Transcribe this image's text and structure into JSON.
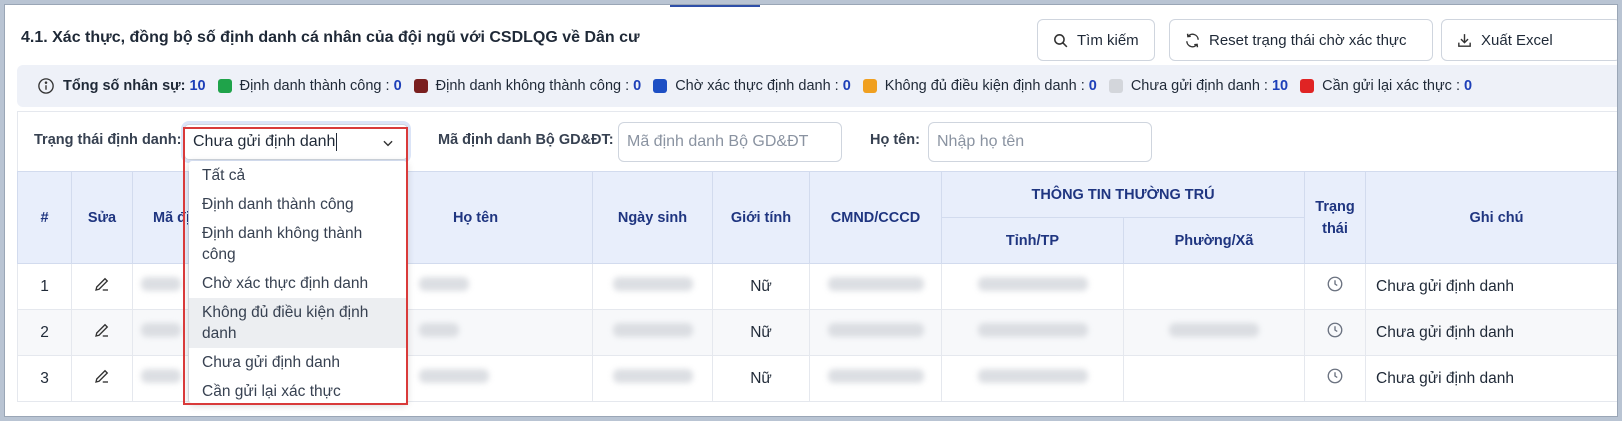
{
  "header": {
    "title": "4.1. Xác thực, đồng bộ số định danh cá nhân của đội ngũ với CSDLQG về Dân cư",
    "buttons": {
      "search": "Tìm kiếm",
      "reset": "Reset trạng thái chờ xác thực",
      "excel": "Xuất Excel"
    }
  },
  "summary": {
    "total_label": "Tổng số nhân sự:",
    "total_value": "10",
    "items": [
      {
        "label": "Định danh thành công :",
        "value": "0",
        "color": "#1fa34a"
      },
      {
        "label": "Định danh không thành công :",
        "value": "0",
        "color": "#7a1f1f"
      },
      {
        "label": "Chờ xác thực định danh :",
        "value": "0",
        "color": "#1d4fc4"
      },
      {
        "label": "Không đủ điều kiện định danh :",
        "value": "0",
        "color": "#f0a020"
      },
      {
        "label": "Chưa gửi định danh :",
        "value": "10",
        "color": "#d3d6db"
      },
      {
        "label": "Cần gửi lại xác thực :",
        "value": "0",
        "color": "#e02424"
      }
    ]
  },
  "filters": {
    "status_label": "Trạng thái định danh:",
    "status_value": "Chưa gửi định danh",
    "moet_id_label": "Mã định danh Bộ GD&ĐT:",
    "moet_id_placeholder": "Mã định danh Bộ GD&ĐT",
    "name_label": "Họ tên:",
    "name_placeholder": "Nhập họ tên"
  },
  "dropdown": {
    "options": [
      "Tất cả",
      "Định danh thành công",
      "Định danh không thành công",
      "Chờ xác thực định danh",
      "Không đủ điều kiện định danh",
      "Chưa gửi định danh",
      "Cần gửi lại xác thực"
    ],
    "hovered_index": 4
  },
  "table": {
    "headers": {
      "index": "#",
      "edit": "Sửa",
      "code": "Mã định danh",
      "name": "Họ tên",
      "dob": "Ngày sinh",
      "gender": "Giới tính",
      "id_card": "CMND/CCCD",
      "residence": "THÔNG TIN THƯỜNG TRÚ",
      "province": "Tỉnh/TP",
      "ward": "Phường/Xã",
      "status": "Trạng thái",
      "note": "Ghi chú"
    },
    "rows": [
      {
        "index": "1",
        "gender": "Nữ",
        "note": "Chưa gửi định danh"
      },
      {
        "index": "2",
        "gender": "Nữ",
        "note": "Chưa gửi định danh"
      },
      {
        "index": "3",
        "gender": "Nữ",
        "note": "Chưa gửi định danh"
      }
    ]
  },
  "icons": {
    "info": "info-circle-icon",
    "search": "search-icon",
    "reset": "refresh-icon",
    "excel": "download-icon",
    "edit": "pencil-icon",
    "status": "clock-icon",
    "chevron": "chevron-down-icon"
  }
}
